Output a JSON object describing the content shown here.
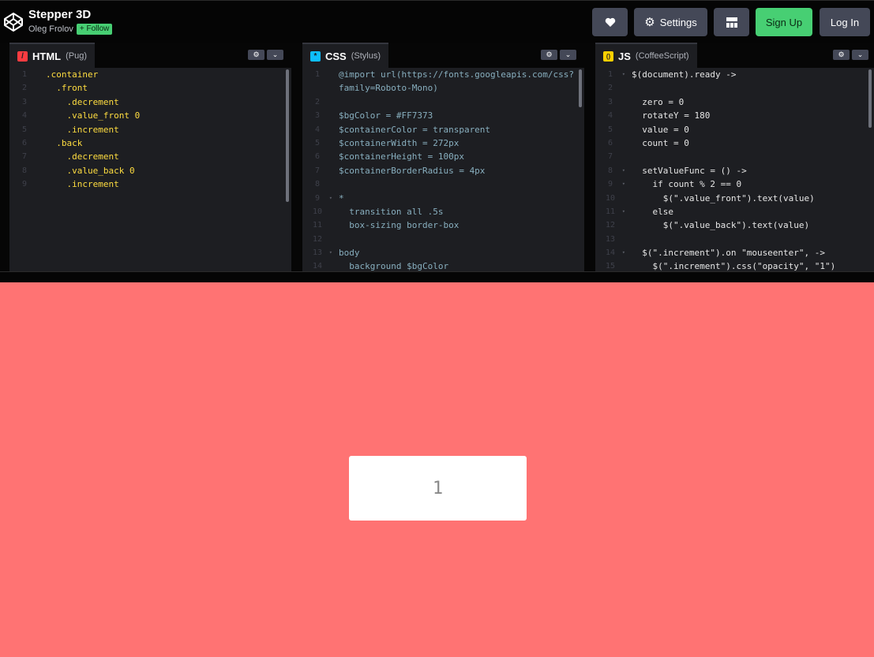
{
  "header": {
    "title": "Stepper 3D",
    "author": "Oleg Frolov",
    "follow_label": "+ Follow",
    "buttons": {
      "love": "heart-icon",
      "settings_label": "Settings",
      "layout": "layout-icon",
      "signup_label": "Sign Up",
      "login_label": "Log In"
    }
  },
  "editors": [
    {
      "lang": "HTML",
      "preprocessor": "(Pug)",
      "icon_color": "#ff3c41",
      "icon_glyph": "/",
      "lines": [
        {
          "n": "1",
          "t": ".container"
        },
        {
          "n": "2",
          "t": "  .front"
        },
        {
          "n": "3",
          "t": "    .decrement"
        },
        {
          "n": "4",
          "t": "    .value_front 0"
        },
        {
          "n": "5",
          "t": "    .increment"
        },
        {
          "n": "6",
          "t": "  .back"
        },
        {
          "n": "7",
          "t": "    .decrement"
        },
        {
          "n": "8",
          "t": "    .value_back 0"
        },
        {
          "n": "9",
          "t": "    .increment"
        }
      ]
    },
    {
      "lang": "CSS",
      "preprocessor": "(Stylus)",
      "icon_color": "#0ebeff",
      "icon_glyph": "*",
      "lines": [
        {
          "n": "1",
          "t": "@import url(https://fonts.googleapis.com/css?"
        },
        {
          "n": "",
          "t": "family=Roboto-Mono)"
        },
        {
          "n": "2",
          "t": ""
        },
        {
          "n": "3",
          "t": "$bgColor = #FF7373"
        },
        {
          "n": "4",
          "t": "$containerColor = transparent"
        },
        {
          "n": "5",
          "t": "$containerWidth = 272px"
        },
        {
          "n": "6",
          "t": "$containerHeight = 100px"
        },
        {
          "n": "7",
          "t": "$containerBorderRadius = 4px"
        },
        {
          "n": "8",
          "t": ""
        },
        {
          "n": "9",
          "t": "*"
        },
        {
          "n": "10",
          "t": "  transition all .5s"
        },
        {
          "n": "11",
          "t": "  box-sizing border-box"
        },
        {
          "n": "12",
          "t": ""
        },
        {
          "n": "13",
          "t": "body"
        },
        {
          "n": "14",
          "t": "  background $bgColor"
        }
      ]
    },
    {
      "lang": "JS",
      "preprocessor": "(CoffeeScript)",
      "icon_color": "#fcd000",
      "icon_glyph": "()",
      "lines": [
        {
          "n": "1",
          "t": "$(document).ready ->"
        },
        {
          "n": "2",
          "t": ""
        },
        {
          "n": "3",
          "t": "  zero = 0"
        },
        {
          "n": "4",
          "t": "  rotateY = 180"
        },
        {
          "n": "5",
          "t": "  value = 0"
        },
        {
          "n": "6",
          "t": "  count = 0"
        },
        {
          "n": "7",
          "t": ""
        },
        {
          "n": "8",
          "t": "  setValueFunc = () ->"
        },
        {
          "n": "9",
          "t": "    if count % 2 == 0"
        },
        {
          "n": "10",
          "t": "      $(\".value_front\").text(value)"
        },
        {
          "n": "11",
          "t": "    else"
        },
        {
          "n": "12",
          "t": "      $(\".value_back\").text(value)"
        },
        {
          "n": "13",
          "t": ""
        },
        {
          "n": "14",
          "t": "  $(\".increment\").on \"mouseenter\", ->"
        },
        {
          "n": "15",
          "t": "    $(\".increment\").css(\"opacity\", \"1\")"
        }
      ]
    }
  ],
  "preview": {
    "background": "#ff7373",
    "stepper_value": "1"
  }
}
